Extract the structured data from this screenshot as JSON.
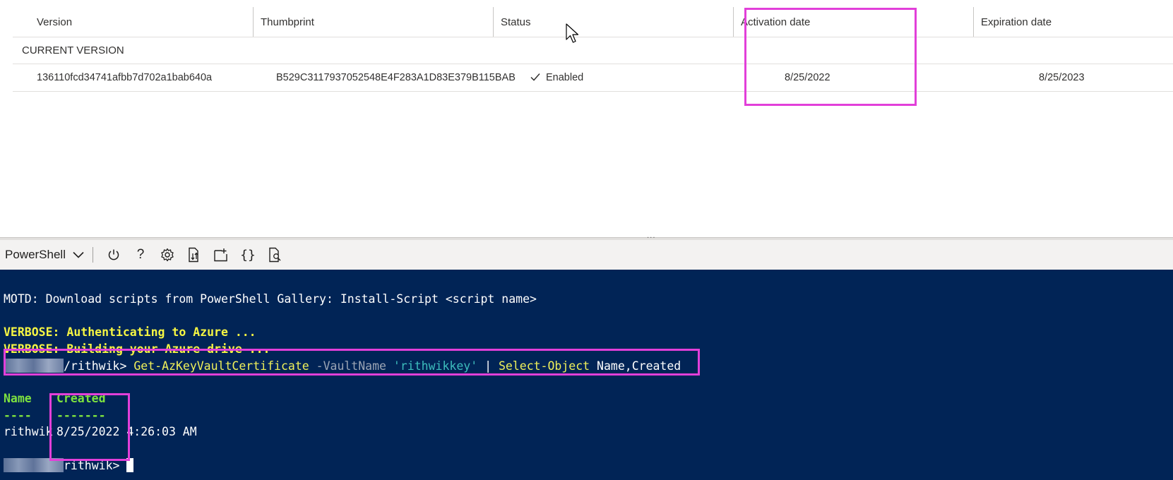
{
  "table": {
    "headers": {
      "version": "Version",
      "thumbprint": "Thumbprint",
      "status": "Status",
      "activation": "Activation date",
      "expiration": "Expiration date"
    },
    "group_label": "CURRENT VERSION",
    "row": {
      "version": "136110fcd34741afbb7d702a1bab640a",
      "thumbprint": "B529C3117937052548E4F283A1D83E379B115BAB",
      "status_icon": "checkmark-icon",
      "status": "Enabled",
      "activation": "8/25/2022",
      "expiration": "8/25/2023"
    }
  },
  "splitter": {
    "grip": "···"
  },
  "toolbar": {
    "shell": "PowerShell",
    "buttons": [
      "power-icon",
      "help-icon",
      "settings-icon",
      "upload-download-icon",
      "open-new-session-icon",
      "editor-braces-icon",
      "web-preview-icon"
    ]
  },
  "terminal": {
    "motd": "MOTD: Download scripts from PowerShell Gallery: Install-Script <script name>",
    "verbose1": "VERBOSE: Authenticating to Azure ...",
    "verbose2": "VERBOSE: Building your Azure drive ...",
    "prompt_user": "/rithwik> ",
    "cmd_get": "Get-AzKeyVaultCertificate",
    "cmd_param": " -VaultName ",
    "cmd_value": "'rithwikkey'",
    "cmd_pipe": " | ",
    "cmd_select": "Select-Object",
    "cmd_args": " Name,Created",
    "col_name": "Name",
    "col_created": "Created",
    "col_name_dash": "----",
    "col_created_dash": "-------",
    "result_name": "rithwik",
    "result_date": "8/25/2022",
    "result_time": " 4:26:03 AM",
    "prompt2": "rithwik> "
  },
  "colors": {
    "highlight": "#e23fd9",
    "terminal_bg": "#012456",
    "verbose": "#f5f543",
    "header_green": "#7ee23f"
  }
}
